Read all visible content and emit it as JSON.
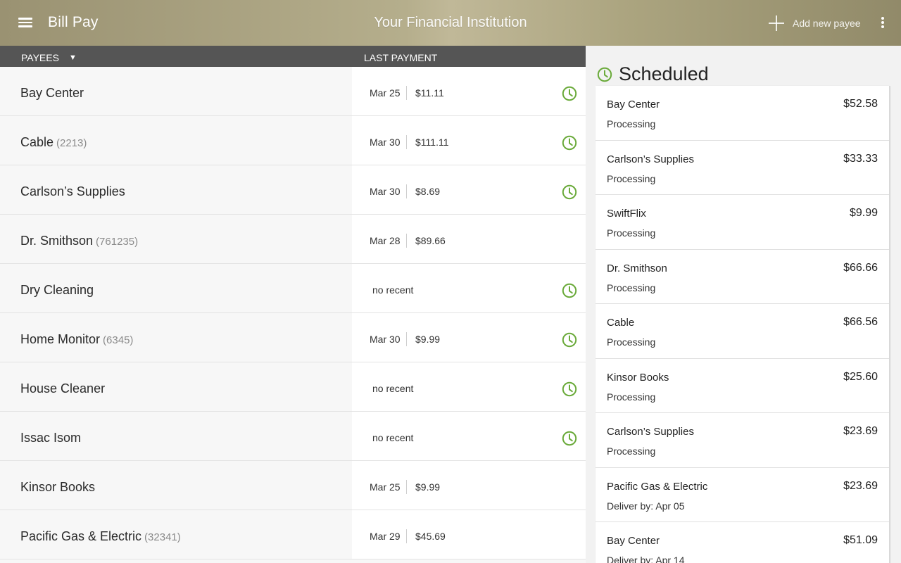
{
  "appbar": {
    "title": "Bill Pay",
    "institution": "Your Financial Institution",
    "add_payee_label": "Add new payee",
    "background_color": "#b0a985"
  },
  "list_header": {
    "payees_label": "PAYEES",
    "sort_indicator": "▼",
    "last_payment_label": "LAST PAYMENT"
  },
  "payees": [
    {
      "name": "Bay Center",
      "account": "",
      "date": "Mar 25",
      "amount": "$11.11",
      "no_recent": "",
      "scheduled": true
    },
    {
      "name": "Cable",
      "account": "(2213)",
      "date": "Mar 30",
      "amount": "$111.11",
      "no_recent": "",
      "scheduled": true
    },
    {
      "name": "Carlson’s Supplies",
      "account": "",
      "date": "Mar 30",
      "amount": "$8.69",
      "no_recent": "",
      "scheduled": true
    },
    {
      "name": "Dr. Smithson",
      "account": "(761235)",
      "date": "Mar 28",
      "amount": "$89.66",
      "no_recent": "",
      "scheduled": false
    },
    {
      "name": "Dry Cleaning",
      "account": "",
      "date": "",
      "amount": "",
      "no_recent": "no recent",
      "scheduled": true
    },
    {
      "name": "Home Monitor",
      "account": "(6345)",
      "date": "Mar 30",
      "amount": "$9.99",
      "no_recent": "",
      "scheduled": true
    },
    {
      "name": "House Cleaner",
      "account": "",
      "date": "",
      "amount": "",
      "no_recent": "no recent",
      "scheduled": true
    },
    {
      "name": "Issac Isom",
      "account": "",
      "date": "",
      "amount": "",
      "no_recent": "no recent",
      "scheduled": true
    },
    {
      "name": "Kinsor Books",
      "account": "",
      "date": "Mar 25",
      "amount": "$9.99",
      "no_recent": "",
      "scheduled": false
    },
    {
      "name": "Pacific Gas & Electric",
      "account": "(32341)",
      "date": "Mar 29",
      "amount": "$45.69",
      "no_recent": "",
      "scheduled": false
    }
  ],
  "scheduled": {
    "title": "Scheduled",
    "items": [
      {
        "name": "Bay Center",
        "amount": "$52.58",
        "status": "Processing"
      },
      {
        "name": "Carlson’s Supplies",
        "amount": "$33.33",
        "status": "Processing"
      },
      {
        "name": "SwiftFlix",
        "amount": "$9.99",
        "status": "Processing"
      },
      {
        "name": "Dr. Smithson",
        "amount": "$66.66",
        "status": "Processing"
      },
      {
        "name": "Cable",
        "amount": "$66.56",
        "status": "Processing"
      },
      {
        "name": "Kinsor Books",
        "amount": "$25.60",
        "status": "Processing"
      },
      {
        "name": "Carlson’s Supplies",
        "amount": "$23.69",
        "status": "Processing"
      },
      {
        "name": "Pacific Gas & Electric",
        "amount": "$23.69",
        "status": "Deliver by: Apr 05"
      },
      {
        "name": "Bay Center",
        "amount": "$51.09",
        "status": "Deliver by: Apr 14"
      }
    ]
  },
  "colors": {
    "accent_green": "#6aaa3a",
    "header_bar": "#555555"
  },
  "icons": {
    "menu": "menu-icon",
    "add": "plus-icon",
    "overflow": "more-vert-icon",
    "scheduled": "clock-icon",
    "sort": "triangle-down-icon"
  }
}
